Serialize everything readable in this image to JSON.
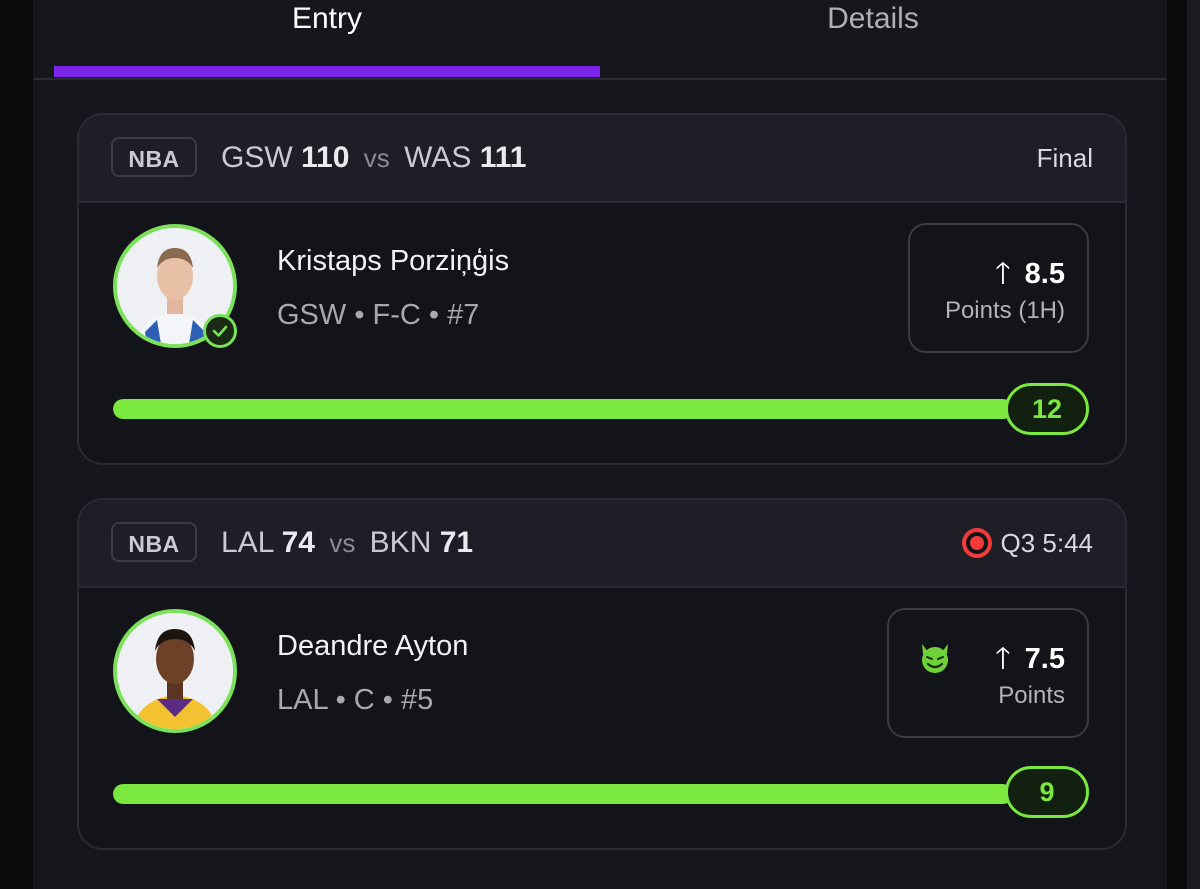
{
  "tabs": [
    {
      "label": "Entry",
      "active": true
    },
    {
      "label": "Details",
      "active": false
    }
  ],
  "colors": {
    "accent_tab": "#7c25ea",
    "progress": "#7be83f",
    "live": "#f23a3a"
  },
  "picks": [
    {
      "league": "NBA",
      "home_team": "GSW",
      "home_score": "110",
      "vs": "vs",
      "away_team": "WAS",
      "away_score": "111",
      "status": "Final",
      "live": false,
      "player_name": "Kristaps Porziņģis",
      "player_meta": "GSW • F-C • #7",
      "direction_icon": "arrow-up-icon",
      "line": "8.5",
      "stat": "Points (1H)",
      "result": "12",
      "progress_fraction": 1.0,
      "hit": true
    },
    {
      "league": "NBA",
      "home_team": "LAL",
      "home_score": "74",
      "vs": "vs",
      "away_team": "BKN",
      "away_score": "71",
      "status": "Q3 5:44",
      "live": true,
      "player_name": "Deandre Ayton",
      "player_meta": "LAL • C • #5",
      "direction_icon": "arrow-up-icon",
      "line": "7.5",
      "stat": "Points",
      "result": "9",
      "progress_fraction": 1.0,
      "modifier_icon": "demon-icon"
    }
  ]
}
